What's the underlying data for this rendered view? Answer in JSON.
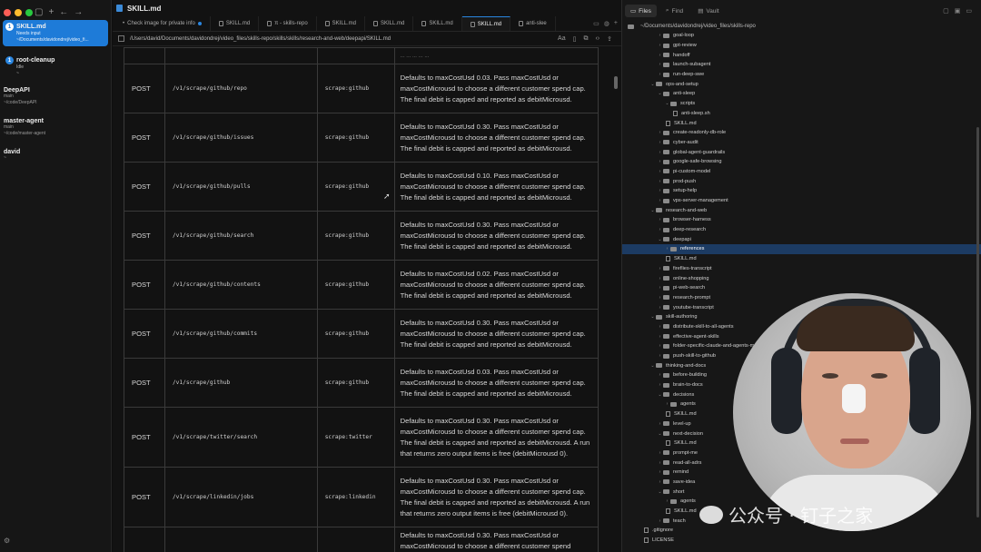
{
  "sidebar": {
    "window_controls": [
      "#ff5f57",
      "#febc2e",
      "#28c840"
    ],
    "toolbar_icons": [
      "sidebar-toggle-icon",
      "new-session-icon",
      "back-arrow-icon",
      "forward-arrow-icon"
    ],
    "sessions": [
      {
        "title": "SKILL.md",
        "badge": "1",
        "status": "Needs input",
        "path": "~/Documents/davidondrej/video_fi..."
      },
      {
        "title": "root-cleanup",
        "badge": "1",
        "status": "Idle",
        "path": "~"
      }
    ],
    "plain_sessions": [
      {
        "title": "DeepAPI",
        "line1": "main",
        "line2": "~/code/DeepAPI"
      },
      {
        "title": "master-agent",
        "line1": "main",
        "line2": "~/code/master-agent"
      },
      {
        "title": "david",
        "line1": "~",
        "line2": ""
      }
    ]
  },
  "editor": {
    "window_title": "SKILL.md",
    "tabs": [
      {
        "label": "Check image for private info",
        "dot": true,
        "active": false
      },
      {
        "label": "SKILL.md",
        "active": false
      },
      {
        "label": "π - skills-repo",
        "active": false
      },
      {
        "label": "SKILL.md",
        "active": false
      },
      {
        "label": "SKILL.md",
        "active": false
      },
      {
        "label": "SKILL.md",
        "active": false
      },
      {
        "label": "SKILL.md",
        "active": true
      },
      {
        "label": "anti-slee",
        "active": false
      }
    ],
    "path": "/Users/david/Documents/davidondrej/video_files/skills-repo/skills/skills/research-and-web/deepapi/SKILL.md",
    "path_tools": [
      "Aa",
      "book-icon",
      "copy-icon",
      "code-icon",
      "share-icon"
    ],
    "top_partial_desc": "... ... ... ... ...",
    "rows": [
      {
        "method": "POST",
        "endpoint": "/v1/scrape/github/repo",
        "scope": "scrape:github",
        "desc": "Defaults to maxCostUsd 0.03. Pass maxCostUsd or maxCostMicrousd to choose a different customer spend cap. The final debit is capped and reported as debitMicrousd."
      },
      {
        "method": "POST",
        "endpoint": "/v1/scrape/github/issues",
        "scope": "scrape:github",
        "desc": "Defaults to maxCostUsd 0.30. Pass maxCostUsd or maxCostMicrousd to choose a different customer spend cap. The final debit is capped and reported as debitMicrousd."
      },
      {
        "method": "POST",
        "endpoint": "/v1/scrape/github/pulls",
        "scope": "scrape:github",
        "desc": "Defaults to maxCostUsd 0.10. Pass maxCostUsd or maxCostMicrousd to choose a different customer spend cap. The final debit is capped and reported as debitMicrousd."
      },
      {
        "method": "POST",
        "endpoint": "/v1/scrape/github/search",
        "scope": "scrape:github",
        "desc": "Defaults to maxCostUsd 0.30. Pass maxCostUsd or maxCostMicrousd to choose a different customer spend cap. The final debit is capped and reported as debitMicrousd."
      },
      {
        "method": "POST",
        "endpoint": "/v1/scrape/github/contents",
        "scope": "scrape:github",
        "desc": "Defaults to maxCostUsd 0.02. Pass maxCostUsd or maxCostMicrousd to choose a different customer spend cap. The final debit is capped and reported as debitMicrousd."
      },
      {
        "method": "POST",
        "endpoint": "/v1/scrape/github/commits",
        "scope": "scrape:github",
        "desc": "Defaults to maxCostUsd 0.30. Pass maxCostUsd or maxCostMicrousd to choose a different customer spend cap. The final debit is capped and reported as debitMicrousd."
      },
      {
        "method": "POST",
        "endpoint": "/v1/scrape/github",
        "scope": "scrape:github",
        "desc": "Defaults to maxCostUsd 0.03. Pass maxCostUsd or maxCostMicrousd to choose a different customer spend cap. The final debit is capped and reported as debitMicrousd."
      },
      {
        "method": "POST",
        "endpoint": "/v1/scrape/twitter/search",
        "scope": "scrape:twitter",
        "desc": "Defaults to maxCostUsd 0.30. Pass maxCostUsd or maxCostMicrousd to choose a different customer spend cap. The final debit is capped and reported as debitMicrousd. A run that returns zero output items is free (debitMicrousd 0)."
      },
      {
        "method": "POST",
        "endpoint": "/v1/scrape/linkedin/jobs",
        "scope": "scrape:linkedin",
        "desc": "Defaults to maxCostUsd 0.30. Pass maxCostUsd or maxCostMicrousd to choose a different customer spend cap. The final debit is capped and reported as debitMicrousd. A run that returns zero output items is free (debitMicrousd 0)."
      },
      {
        "method": "",
        "endpoint": "",
        "scope": "",
        "desc": "Defaults to maxCostUsd 0.30. Pass maxCostUsd or maxCostMicrousd to choose a different customer spend"
      }
    ]
  },
  "explorer": {
    "tabs": [
      {
        "label": "Files",
        "active": true
      },
      {
        "label": "Find",
        "active": false
      },
      {
        "label": "Vault",
        "active": false
      }
    ],
    "tool_icons": [
      "new-file-icon",
      "new-folder-icon",
      "collapse-icon"
    ],
    "root": "~/Documents/davidondrej/video_files/skills-repo",
    "items": [
      {
        "label": "goal-loop",
        "depth": 2,
        "type": "folder",
        "open": false
      },
      {
        "label": "gpt-review",
        "depth": 2,
        "type": "folder",
        "open": false
      },
      {
        "label": "handoff",
        "depth": 2,
        "type": "folder",
        "open": false
      },
      {
        "label": "launch-subagent",
        "depth": 2,
        "type": "folder",
        "open": false
      },
      {
        "label": "run-deep-swe",
        "depth": 2,
        "type": "folder",
        "open": false
      },
      {
        "label": "ops-and-setup",
        "depth": 1,
        "type": "folder",
        "open": true
      },
      {
        "label": "anti-sleep",
        "depth": 2,
        "type": "folder",
        "open": true
      },
      {
        "label": "scripts",
        "depth": 3,
        "type": "folder",
        "open": true
      },
      {
        "label": "anti-sleep.sh",
        "depth": 4,
        "type": "file"
      },
      {
        "label": "SKILL.md",
        "depth": 3,
        "type": "file"
      },
      {
        "label": "create-readonly-db-role",
        "depth": 2,
        "type": "folder",
        "open": false
      },
      {
        "label": "cyber-audit",
        "depth": 2,
        "type": "folder",
        "open": false
      },
      {
        "label": "global-agent-guardrails",
        "depth": 2,
        "type": "folder",
        "open": false
      },
      {
        "label": "google-safe-browsing",
        "depth": 2,
        "type": "folder",
        "open": false
      },
      {
        "label": "pi-custom-model",
        "depth": 2,
        "type": "folder",
        "open": false
      },
      {
        "label": "prod-push",
        "depth": 2,
        "type": "folder",
        "open": false
      },
      {
        "label": "setup-help",
        "depth": 2,
        "type": "folder",
        "open": false
      },
      {
        "label": "vps-server-management",
        "depth": 2,
        "type": "folder",
        "open": false
      },
      {
        "label": "research-and-web",
        "depth": 1,
        "type": "folder",
        "open": true
      },
      {
        "label": "browser-harness",
        "depth": 2,
        "type": "folder",
        "open": false
      },
      {
        "label": "deep-research",
        "depth": 2,
        "type": "folder",
        "open": false
      },
      {
        "label": "deepapi",
        "depth": 2,
        "type": "folder",
        "open": true
      },
      {
        "label": "references",
        "depth": 3,
        "type": "folder",
        "open": false,
        "selected": true
      },
      {
        "label": "SKILL.md",
        "depth": 3,
        "type": "file"
      },
      {
        "label": "fireflies-transcript",
        "depth": 2,
        "type": "folder",
        "open": false
      },
      {
        "label": "online-shopping",
        "depth": 2,
        "type": "folder",
        "open": false
      },
      {
        "label": "pi-web-search",
        "depth": 2,
        "type": "folder",
        "open": false
      },
      {
        "label": "research-prompt",
        "depth": 2,
        "type": "folder",
        "open": false
      },
      {
        "label": "youtube-transcript",
        "depth": 2,
        "type": "folder",
        "open": false
      },
      {
        "label": "skill-authoring",
        "depth": 1,
        "type": "folder",
        "open": true
      },
      {
        "label": "distribute-skill-to-all-agents",
        "depth": 2,
        "type": "folder",
        "open": false
      },
      {
        "label": "effective-agent-skills",
        "depth": 2,
        "type": "folder",
        "open": false
      },
      {
        "label": "folder-specific-claude-and-agents-md",
        "depth": 2,
        "type": "folder",
        "open": false
      },
      {
        "label": "push-skill-to-github",
        "depth": 2,
        "type": "folder",
        "open": false
      },
      {
        "label": "thinking-and-docs",
        "depth": 1,
        "type": "folder",
        "open": true
      },
      {
        "label": "before-building",
        "depth": 2,
        "type": "folder",
        "open": false
      },
      {
        "label": "brain-to-docs",
        "depth": 2,
        "type": "folder",
        "open": false
      },
      {
        "label": "decisions",
        "depth": 2,
        "type": "folder",
        "open": true
      },
      {
        "label": "agents",
        "depth": 3,
        "type": "folder",
        "open": false
      },
      {
        "label": "SKILL.md",
        "depth": 3,
        "type": "file"
      },
      {
        "label": "level-up",
        "depth": 2,
        "type": "folder",
        "open": false
      },
      {
        "label": "next-decision",
        "depth": 2,
        "type": "folder",
        "open": true
      },
      {
        "label": "SKILL.md",
        "depth": 3,
        "type": "file"
      },
      {
        "label": "prompt-me",
        "depth": 2,
        "type": "folder",
        "open": false
      },
      {
        "label": "read-all-adrs",
        "depth": 2,
        "type": "folder",
        "open": false
      },
      {
        "label": "remind",
        "depth": 2,
        "type": "folder",
        "open": false
      },
      {
        "label": "save-idea",
        "depth": 2,
        "type": "folder",
        "open": false
      },
      {
        "label": "short",
        "depth": 2,
        "type": "folder",
        "open": true
      },
      {
        "label": "agents",
        "depth": 3,
        "type": "folder",
        "open": false
      },
      {
        "label": "SKILL.md",
        "depth": 3,
        "type": "file"
      },
      {
        "label": "teach",
        "depth": 2,
        "type": "folder",
        "open": false
      },
      {
        "label": ".gitignore",
        "depth": 0,
        "type": "file"
      },
      {
        "label": "LICENSE",
        "depth": 0,
        "type": "file"
      }
    ]
  },
  "overlay": {
    "watermark": "公众号 · 钉子之家",
    "accent": "#2a86e0"
  }
}
